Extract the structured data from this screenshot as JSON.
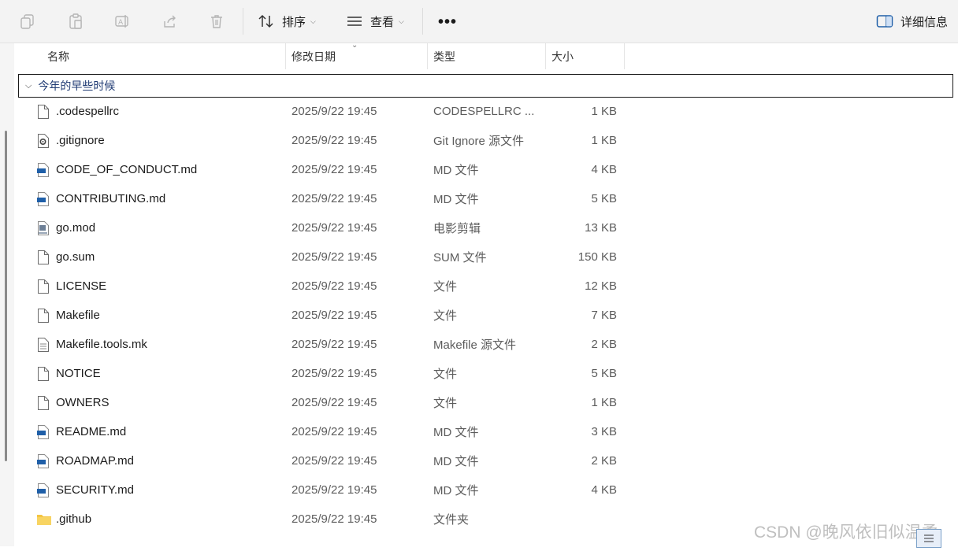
{
  "toolbar": {
    "sort_label": "排序",
    "view_label": "查看",
    "more_label": "•••",
    "details_label": "详细信息"
  },
  "columns": {
    "name": "名称",
    "date": "修改日期",
    "type": "类型",
    "size": "大小"
  },
  "group": {
    "label": "今年的早些时候"
  },
  "files": [
    {
      "name": ".codespellrc",
      "date": "2025/9/22 19:45",
      "type": "CODESPELLRC ...",
      "size": "1 KB",
      "icon": "blank-file-icon"
    },
    {
      "name": ".gitignore",
      "date": "2025/9/22 19:45",
      "type": "Git Ignore 源文件",
      "size": "1 KB",
      "icon": "settings-file-icon"
    },
    {
      "name": "CODE_OF_CONDUCT.md",
      "date": "2025/9/22 19:45",
      "type": "MD 文件",
      "size": "4 KB",
      "icon": "markdown-file-icon"
    },
    {
      "name": "CONTRIBUTING.md",
      "date": "2025/9/22 19:45",
      "type": "MD 文件",
      "size": "5 KB",
      "icon": "markdown-file-icon"
    },
    {
      "name": "go.mod",
      "date": "2025/9/22 19:45",
      "type": "电影剪辑",
      "size": "13 KB",
      "icon": "video-file-icon"
    },
    {
      "name": "go.sum",
      "date": "2025/9/22 19:45",
      "type": "SUM 文件",
      "size": "150 KB",
      "icon": "blank-file-icon"
    },
    {
      "name": "LICENSE",
      "date": "2025/9/22 19:45",
      "type": "文件",
      "size": "12 KB",
      "icon": "blank-file-icon"
    },
    {
      "name": "Makefile",
      "date": "2025/9/22 19:45",
      "type": "文件",
      "size": "7 KB",
      "icon": "blank-file-icon"
    },
    {
      "name": "Makefile.tools.mk",
      "date": "2025/9/22 19:45",
      "type": "Makefile 源文件",
      "size": "2 KB",
      "icon": "text-file-icon"
    },
    {
      "name": "NOTICE",
      "date": "2025/9/22 19:45",
      "type": "文件",
      "size": "5 KB",
      "icon": "blank-file-icon"
    },
    {
      "name": "OWNERS",
      "date": "2025/9/22 19:45",
      "type": "文件",
      "size": "1 KB",
      "icon": "blank-file-icon"
    },
    {
      "name": "README.md",
      "date": "2025/9/22 19:45",
      "type": "MD 文件",
      "size": "3 KB",
      "icon": "markdown-file-icon"
    },
    {
      "name": "ROADMAP.md",
      "date": "2025/9/22 19:45",
      "type": "MD 文件",
      "size": "2 KB",
      "icon": "markdown-file-icon"
    },
    {
      "name": "SECURITY.md",
      "date": "2025/9/22 19:45",
      "type": "MD 文件",
      "size": "4 KB",
      "icon": "markdown-file-icon"
    },
    {
      "name": ".github",
      "date": "2025/9/22 19:45",
      "type": "文件夹",
      "size": "",
      "icon": "folder-icon"
    }
  ],
  "watermark": "CSDN @晚风依旧似温柔",
  "colors": {
    "toolbar_bg": "#f3f3f3",
    "group_text": "#1f3a73",
    "secondary_text": "#5c5c5c",
    "folder": "#f4c542",
    "md_badge": "#1f5fa8"
  }
}
